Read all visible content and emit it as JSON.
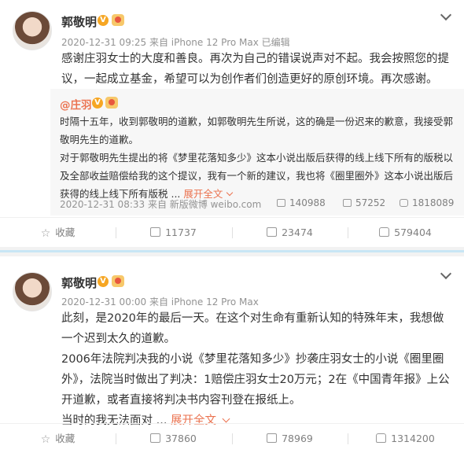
{
  "posts": [
    {
      "username": "郭敬明",
      "meta": "2020-12-31 09:25 来自 iPhone 12 Pro Max   已编辑",
      "text": "感谢庄羽女士的大度和善良。再次为自己的错误说声对不起。我会按照您的提议，一起成立基金，希望可以为创作者们创造更好的原创环境。再次感谢。",
      "repost": {
        "user": "@庄羽",
        "text_a": "时隔十五年，收到郭敬明的道歉，如郭敬明先生所说，这的确是一份迟来的歉意，我接受郭敬明先生的道歉。",
        "text_b": "对于郭敬明先生提出的将《梦里花落知多少》这本小说出版后获得的线上线下所有的版税以及全部收益赔偿给我的这个提议，我有一个新的建议，我也将《圈里圈外》这本小说出版后获得的线上线下所有版税 ...",
        "expand": "展开全文",
        "meta": "2020-12-31 08:33 来自 新版微博 weibo.com",
        "reposts": "140988",
        "comments": "57252",
        "likes": "1818089"
      },
      "actions": {
        "favorite": "收藏",
        "reposts": "11737",
        "comments": "23474",
        "likes": "579404"
      }
    },
    {
      "username": "郭敬明",
      "meta": "2020-12-31 00:00 来自 iPhone 12 Pro Max",
      "para1": "此刻，是2020年的最后一天。在这个对生命有重新认知的特殊年末，我想做一个迟到太久的道歉。",
      "para2": "2006年法院判决我的小说《梦里花落知多少》抄袭庄羽女士的小说《圈里圈外》，法院当时做出了判决：1赔偿庄羽女士20万元；2在《中国青年报》上公开道歉，或者直接将判决书内容刊登在报纸上。",
      "para3": "当时的我无法面对 ...",
      "expand": "展开全文",
      "actions": {
        "favorite": "收藏",
        "reposts": "37860",
        "comments": "78969",
        "likes": "1314200"
      }
    }
  ],
  "badges": {
    "v": "V"
  },
  "icons": {
    "star": "☆",
    "accent": "#eb7350",
    "verified": "#f6a623"
  }
}
